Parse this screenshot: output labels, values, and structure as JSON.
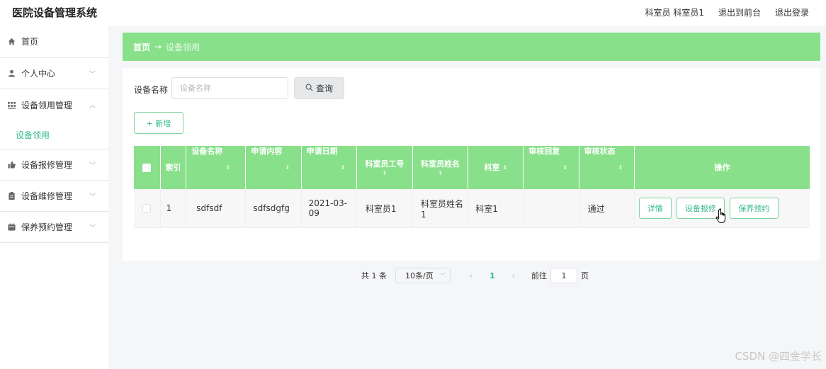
{
  "header": {
    "app_title": "医院设备管理系统",
    "user_info": "科室员 科室员1",
    "back_to_front": "退出到前台",
    "logout": "退出登录"
  },
  "sidebar": {
    "items": [
      {
        "label": "首页",
        "icon": "home-icon"
      },
      {
        "label": "个人中心",
        "icon": "user-icon"
      },
      {
        "label": "设备领用管理",
        "icon": "grid-icon",
        "sub": "设备领用"
      },
      {
        "label": "设备报修管理",
        "icon": "thumb-icon"
      },
      {
        "label": "设备维修管理",
        "icon": "clipboard-icon"
      },
      {
        "label": "保养预约管理",
        "icon": "calendar-icon"
      }
    ]
  },
  "breadcrumb": {
    "home": "首页",
    "separator": "→",
    "current": "设备领用"
  },
  "search": {
    "label": "设备名称",
    "placeholder": "设备名称",
    "button": "查询"
  },
  "add_button": "+ 新增",
  "table": {
    "headers": [
      "索引",
      "设备名称",
      "申请内容",
      "申请日期",
      "科室员工号",
      "科室员姓名",
      "科室",
      "审核回复",
      "审核状态",
      "操作"
    ],
    "sort_mark": "⬍",
    "rows": [
      {
        "index": "1",
        "name": "sdfsdf",
        "content": "sdfsdgfg",
        "date": "2021-03-09",
        "staff_no": "科室员1",
        "staff_name": "科室员姓名1",
        "dept": "科室1",
        "reply": "",
        "status": "通过",
        "actions": [
          "详情",
          "设备报修",
          "保养预约"
        ]
      }
    ]
  },
  "pagination": {
    "total": "共 1 条",
    "page_size": "10条/页",
    "prev": "‹",
    "page": "1",
    "next": "›",
    "goto_label": "前往",
    "goto_value": "1",
    "page_suffix": "页"
  },
  "colors": {
    "accent": "#88e08a",
    "link": "#35b88f"
  },
  "watermark": "CSDN @四金学长"
}
